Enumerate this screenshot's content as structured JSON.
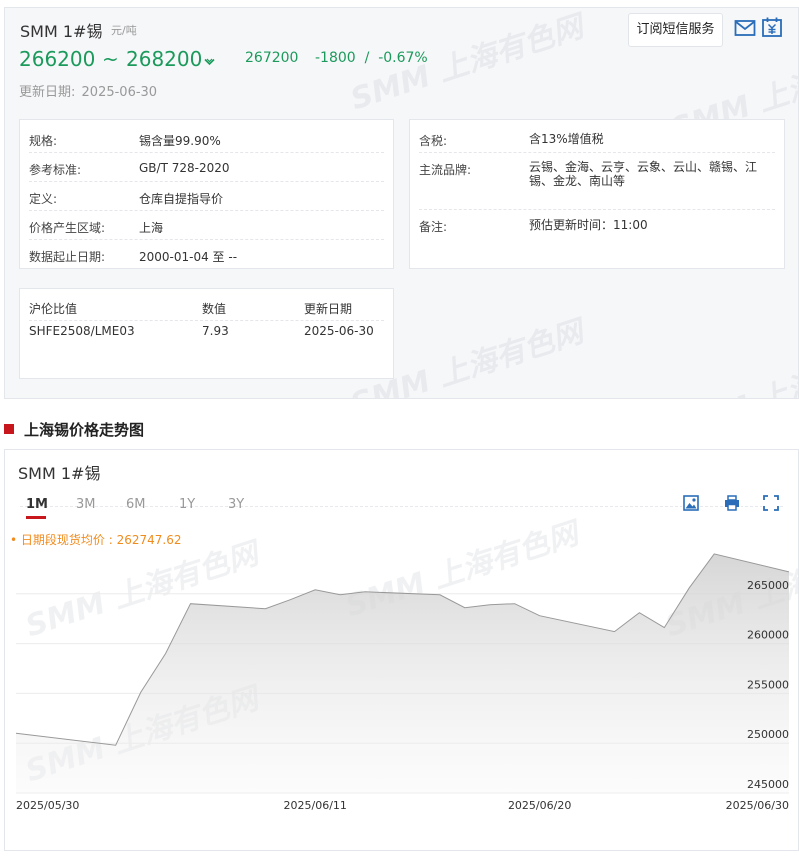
{
  "product": {
    "title": "SMM 1#锡",
    "unit": "元/吨",
    "price_low": "266200",
    "price_sep": "~",
    "price_high": "268200",
    "avg_price": "267200",
    "change": "-1800  /  -0.67%",
    "update_label": "更新日期:",
    "update_date": "2025-06-30",
    "subscribe_label": "订阅短信服务",
    "trend_color": "#1c9a5c"
  },
  "watermark": "SMM 上海有色网",
  "specs_left": [
    {
      "key": "规格:",
      "value": "锡含量99.90%"
    },
    {
      "key": "参考标准:",
      "value": "GB/T 728-2020"
    },
    {
      "key": "定义:",
      "value": "仓库自提指导价"
    },
    {
      "key": "价格产生区域:",
      "value": "上海"
    },
    {
      "key": "数据起止日期:",
      "value": "2000-01-04 至 --"
    }
  ],
  "specs_right": [
    {
      "key": "含税:",
      "value": "含13%增值税"
    },
    {
      "key": "主流品牌:",
      "value": "云锡、金海、云亨、云象、云山、赣锡、江锡、金龙、南山等"
    },
    {
      "key": "备注:",
      "value": "预估更新时间：11:00"
    }
  ],
  "ratio": {
    "headers": [
      "沪伦比值",
      "数值",
      "更新日期"
    ],
    "row": [
      "SHFE2508/LME03",
      "7.93",
      "2025-06-30"
    ]
  },
  "section_title": "上海锡价格走势图",
  "chart": {
    "title": "SMM 1#锡",
    "tabs": [
      "1M",
      "3M",
      "6M",
      "1Y",
      "3Y"
    ],
    "active_tab": "1M",
    "avg_label": "• 日期段现货均价 : 262747.62",
    "accent_color": "#c8161d",
    "avg_color": "#f08c1e"
  },
  "chart_data": {
    "type": "area",
    "x": [
      "2025-05-30",
      "2025-06-03",
      "2025-06-04",
      "2025-06-05",
      "2025-06-06",
      "2025-06-09",
      "2025-06-10",
      "2025-06-11",
      "2025-06-12",
      "2025-06-13",
      "2025-06-16",
      "2025-06-17",
      "2025-06-18",
      "2025-06-19",
      "2025-06-20",
      "2025-06-23",
      "2025-06-24",
      "2025-06-25",
      "2025-06-26",
      "2025-06-27",
      "2025-06-30"
    ],
    "series": [
      {
        "values": [
          251000,
          249800,
          255100,
          259000,
          264000,
          263500,
          264400,
          265400,
          264900,
          265200,
          264900,
          263600,
          263900,
          264000,
          262800,
          261200,
          263100,
          261600,
          265600,
          269000,
          267200
        ]
      }
    ],
    "x_tick_labels": [
      "2025/05/30",
      "2025/06/11",
      "2025/06/20",
      "2025/06/30"
    ],
    "y_ticks": [
      245000,
      250000,
      255000,
      260000,
      265000
    ],
    "ylim": [
      245000,
      271000
    ],
    "grid": true,
    "line_color": "#999999"
  }
}
